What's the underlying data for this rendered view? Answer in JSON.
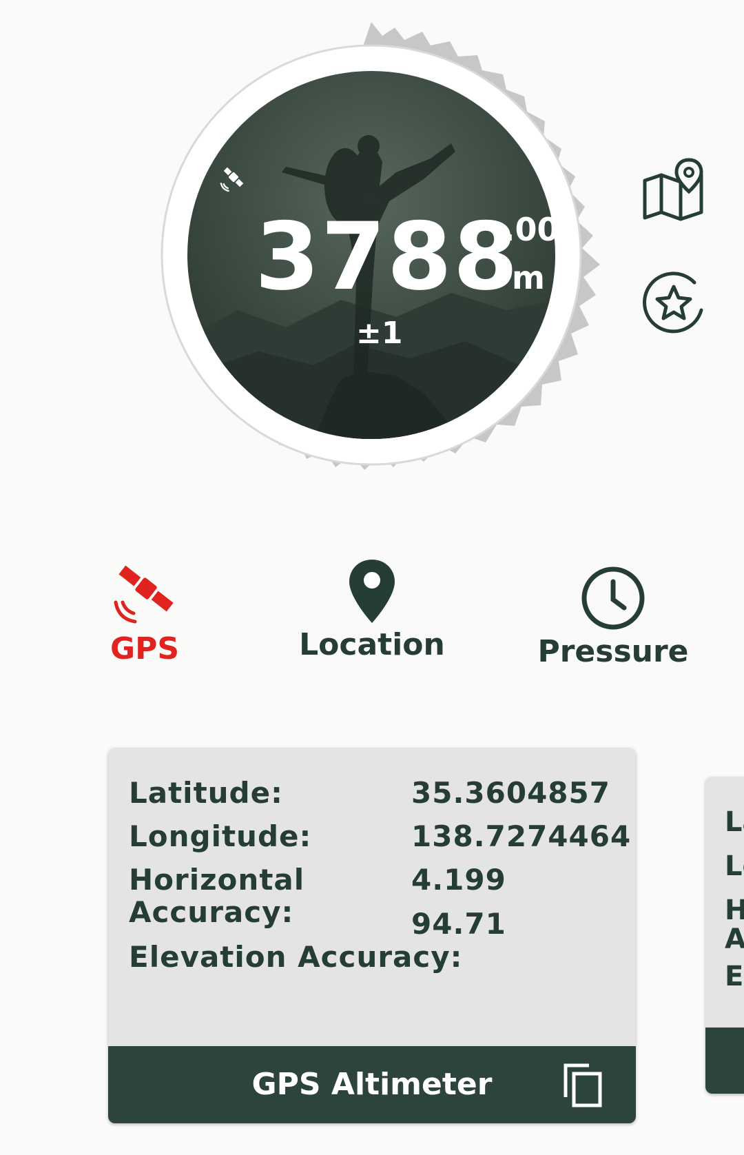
{
  "altitude": {
    "main": "3788",
    "decimal": ".00",
    "unit": "m",
    "accuracy": "±1"
  },
  "icons": {
    "dial_satellite": "satellite-icon",
    "map": "map-pin-icon",
    "favorite": "star-icon",
    "copy": "copy-icon"
  },
  "tabs": [
    {
      "label": "GPS",
      "icon": "satellite-icon",
      "active": true
    },
    {
      "label": "Location",
      "icon": "location-pin-icon",
      "active": false
    },
    {
      "label": "Pressure",
      "icon": "clock-icon",
      "active": false
    }
  ],
  "card": {
    "rows": [
      {
        "label": "Latitude:",
        "value": "35.3604857"
      },
      {
        "label": "Longitude:",
        "value": "138.7274464"
      },
      {
        "label": "Horizontal\nAccuracy:",
        "value": "4.199"
      },
      {
        "label": "Elevation Accuracy:",
        "value": "94.71"
      }
    ],
    "title": "GPS Altimeter"
  },
  "card2": {
    "peek": [
      "La",
      "Lo",
      "H",
      "A",
      "El"
    ]
  },
  "colors": {
    "accent": "#e0231f",
    "primary": "#2c4439",
    "dial_bg": "#3b4a42",
    "card_bg": "#e4e4e4"
  }
}
